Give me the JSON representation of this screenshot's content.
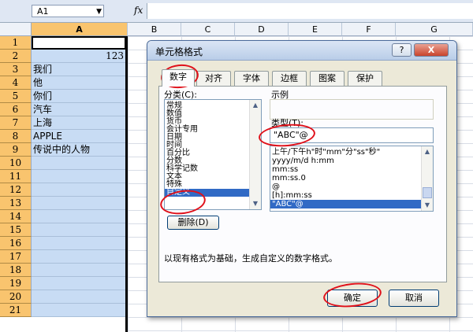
{
  "formula_bar": {
    "name_box": "A1",
    "fx": "fx"
  },
  "columns": [
    "A",
    "B",
    "C",
    "D",
    "E",
    "F",
    "G"
  ],
  "rows": [
    {
      "n": "1",
      "a": ""
    },
    {
      "n": "2",
      "a": "123"
    },
    {
      "n": "3",
      "a": "我们"
    },
    {
      "n": "4",
      "a": "他"
    },
    {
      "n": "5",
      "a": "你们"
    },
    {
      "n": "6",
      "a": "汽车"
    },
    {
      "n": "7",
      "a": "上海"
    },
    {
      "n": "8",
      "a": "APPLE"
    },
    {
      "n": "9",
      "a": "传说中的人物"
    },
    {
      "n": "10",
      "a": ""
    },
    {
      "n": "11",
      "a": ""
    },
    {
      "n": "12",
      "a": ""
    },
    {
      "n": "13",
      "a": ""
    },
    {
      "n": "14",
      "a": ""
    },
    {
      "n": "15",
      "a": ""
    },
    {
      "n": "16",
      "a": ""
    },
    {
      "n": "17",
      "a": ""
    },
    {
      "n": "18",
      "a": ""
    },
    {
      "n": "19",
      "a": ""
    },
    {
      "n": "20",
      "a": ""
    },
    {
      "n": "21",
      "a": ""
    }
  ],
  "dialog": {
    "title": "单元格格式",
    "help": "?",
    "close": "X",
    "tabs": [
      "数字",
      "对齐",
      "字体",
      "边框",
      "图案",
      "保护"
    ],
    "category_label": "分类(C):",
    "categories": [
      "常规",
      "数值",
      "货币",
      "会计专用",
      "日期",
      "时间",
      "百分比",
      "分数",
      "科学记数",
      "文本",
      "特殊",
      "自定义"
    ],
    "selected_category": "自定义",
    "sample_label": "示例",
    "sample_value": "",
    "type_label": "类型(T):",
    "type_value": "\"ABC\"@",
    "formats": [
      "上午/下午h\"时\"mm\"分\"ss\"秒\"",
      "yyyy/m/d h:mm",
      "mm:ss",
      "mm:ss.0",
      "@",
      "[h]:mm:ss",
      "\"ABC\"@"
    ],
    "selected_format": "\"ABC\"@",
    "delete_button": "删除(D)",
    "description": "以现有格式为基础，生成自定义的数字格式。",
    "ok_button": "确定",
    "cancel_button": "取消"
  },
  "colors": {
    "annotation": "#e0101a",
    "selection": "#316ac5",
    "row_header": "#f9c46e",
    "selected_range": "#c8dcf4"
  }
}
